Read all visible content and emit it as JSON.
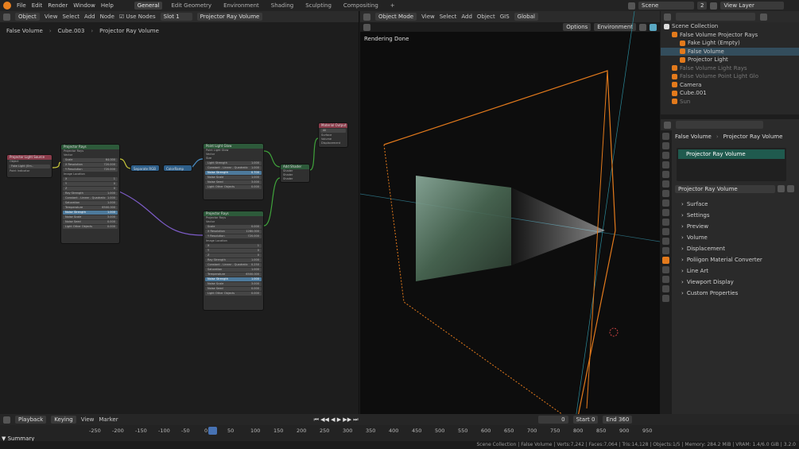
{
  "menu": {
    "items": [
      "File",
      "Edit",
      "Render",
      "Window",
      "Help"
    ],
    "tabs": [
      "General",
      "Edit Geometry",
      "Environment",
      "Shading",
      "Sculpting",
      "Compositing"
    ],
    "active_tab": "General",
    "plus": "+",
    "scene": "Scene",
    "scene_count": "2",
    "view_layer": "View Layer"
  },
  "node_editor": {
    "mode": "Object",
    "menus": [
      "View",
      "Select",
      "Add",
      "Node"
    ],
    "use_nodes": "Use Nodes",
    "slot": "Slot 1",
    "material": "Projector Ray Volume",
    "breadcrumb": [
      "False Volume",
      "Cube.003",
      "Projector Ray Volume"
    ]
  },
  "viewport": {
    "mode": "Object Mode",
    "menus": [
      "View",
      "Select",
      "Add",
      "Object",
      "GIS"
    ],
    "orientation": "Global",
    "render_status": "Rendering Done",
    "options": "Options",
    "environment": "Environment"
  },
  "outliner": {
    "root": "Scene Collection",
    "items": [
      {
        "label": "False Volume Projector Rays",
        "indent": 1
      },
      {
        "label": "Fake Light (Empty)",
        "indent": 2
      },
      {
        "label": "False Volume",
        "indent": 2,
        "selected": true
      },
      {
        "label": "Projector Light",
        "indent": 2
      },
      {
        "label": "False Volume Light Rays",
        "indent": 1,
        "dim": true
      },
      {
        "label": "False Volume Point Light Glo",
        "indent": 1,
        "dim": true
      },
      {
        "label": "Camera",
        "indent": 1
      },
      {
        "label": "Cube.001",
        "indent": 1
      },
      {
        "label": "Sun",
        "indent": 1,
        "dim": true
      }
    ]
  },
  "properties": {
    "breadcrumb_object": "False Volume",
    "breadcrumb_material": "Projector Ray Volume",
    "slot_item": "Projector Ray Volume",
    "material_field": "Projector Ray Volume",
    "sections": [
      "Surface",
      "Settings",
      "Preview",
      "Volume",
      "Displacement",
      "Poliigon Material Converter",
      "Line Art",
      "Viewport Display",
      "Custom Properties"
    ]
  },
  "timeline": {
    "menus": [
      "Playback",
      "Keying",
      "View",
      "Marker"
    ],
    "current_frame": "0",
    "start_label": "Start",
    "start": "0",
    "end_label": "End",
    "end": "360",
    "ticks": [
      "-250",
      "-200",
      "-150",
      "-100",
      "-50",
      "0",
      "50",
      "100",
      "150",
      "200",
      "250",
      "300",
      "350",
      "400",
      "450",
      "500",
      "550",
      "600",
      "650",
      "700",
      "750",
      "800",
      "850",
      "900",
      "950"
    ],
    "summary": "Summary"
  },
  "statusbar": {
    "text": "Scene Collection | False Volume | Verts:7,242 | Faces:7,064 | Tris:14,128 | Objects:1/5 | Memory: 284.2 MiB | VRAM: 1.4/6.0 GiB | 3.2.0"
  },
  "nodes": {
    "texcoord": {
      "title": "Projector Light Source",
      "rows": [
        "Object",
        "Fake Light (Em..",
        "Point Indicator"
      ]
    },
    "ray1": {
      "title": "Projector Rays",
      "rows": [
        "Projector Rays",
        "Vector",
        "Scale",
        "X Resolution",
        "Y Resolution",
        "Image Location",
        "X",
        "Y",
        "Z",
        "Ray Strength",
        "Constant - Linear - Quadratic",
        "Saturation",
        "Temperature",
        "Noise Strength",
        "Noise Scale",
        "Noise Seed",
        "Light Other Objects"
      ],
      "values": [
        "",
        "",
        "64.000",
        "720.000",
        "720.000",
        "",
        "1",
        "0",
        "0",
        "1.000",
        "1.000",
        "1.000",
        "6500.000",
        "1.000",
        "3.000",
        "0.000",
        "0.000"
      ]
    },
    "ray2": {
      "title": "Projector Rays",
      "rows": [
        "Projector Rays",
        "Vector",
        "Scale",
        "X Resolution",
        "Y Resolution",
        "Image Location",
        "X",
        "Y",
        "Z",
        "Ray Strength",
        "Constant - Linear - Quadratic",
        "Saturation",
        "Temperature",
        "Noise Strength",
        "Noise Scale",
        "Noise Seed",
        "Light Other Objects"
      ],
      "values": [
        "",
        "",
        "0.000",
        "1280.000",
        "720.000",
        "",
        "1",
        "0",
        "0",
        "1.000",
        "0.250",
        "1.000",
        "6500.000",
        "1.000",
        "3.000",
        "0.000",
        "0.000"
      ]
    },
    "point": {
      "title": "Point Light Glow",
      "rows": [
        "Point Light Glow",
        "Vector",
        "Size",
        "Light Strength",
        "Constant - Linear - Quadratic",
        "Noise Strength",
        "Noise Scale",
        "Noise Seed",
        "Light Other Objects"
      ],
      "values": [
        "",
        "",
        "",
        "1.000",
        "1.000",
        "0.700",
        "1.000",
        "3.000",
        "0.000"
      ]
    },
    "reroute1": {
      "title": "Separate RGB"
    },
    "reroute2": {
      "title": "ColorRamp"
    },
    "addshader": {
      "title": "Add Shader",
      "rows": [
        "Shader",
        "Shader",
        "Shader"
      ]
    },
    "output": {
      "title": "Material Output",
      "rows": [
        "All",
        "Surface",
        "Volume",
        "Displacement"
      ]
    }
  },
  "colors": {
    "accent": "#e37a1c",
    "select": "#5aa7c2",
    "green": "#3fa33b",
    "bg": "#1d1d1d"
  }
}
